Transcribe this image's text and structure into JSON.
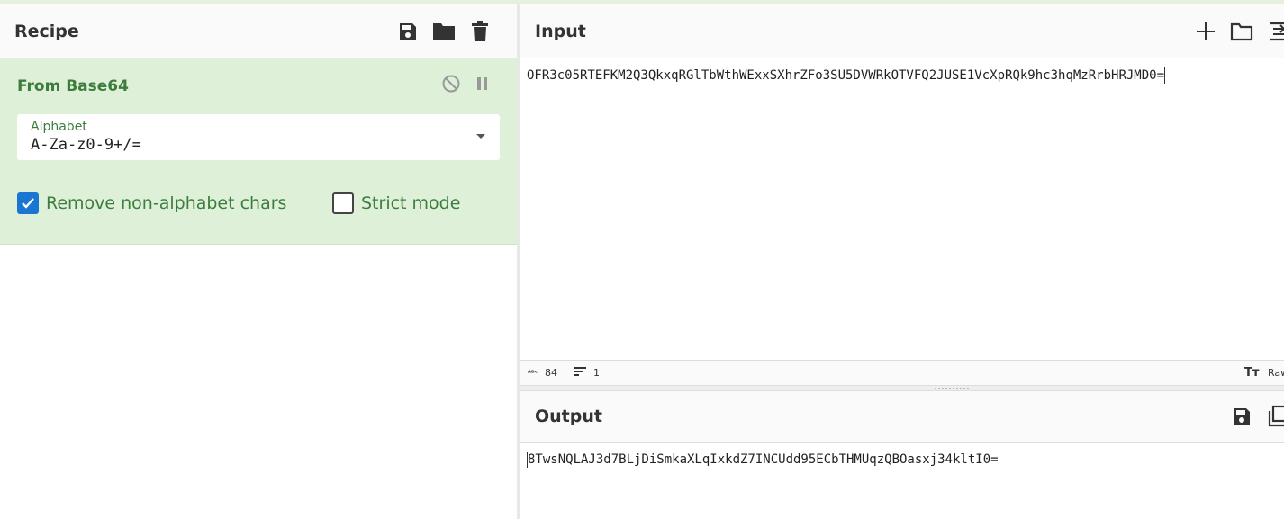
{
  "recipe": {
    "title": "Recipe",
    "icons": [
      "save-icon",
      "folder-icon",
      "trash-icon"
    ]
  },
  "operation": {
    "title": "From Base64",
    "alphabet_label": "Alphabet",
    "alphabet_value": "A-Za-z0-9+/=",
    "remove_nonalphabet_label": "Remove non-alphabet chars",
    "remove_nonalphabet_checked": true,
    "strict_mode_label": "Strict mode",
    "strict_mode_checked": false
  },
  "input": {
    "title": "Input",
    "text": "OFR3c05RTEFKM2Q3QkxqRGlTbWthWExxSXhrZFo3SU5DVWRkOTVFQ2JUSE1VcXpRQk9hc3hqMzRrbHRJMD0=",
    "char_count": "84",
    "line_count": "1",
    "format": "Raw"
  },
  "output": {
    "title": "Output",
    "text": "8TwsNQLAJ3d7BLjDiSmkaXLqIxkdZ7INCUdd95ECbTHMUqzQBOasxj34kltI0="
  },
  "colors": {
    "accent": "#3c7d3e",
    "operation_bg": "#dff0d8",
    "checkbox": "#1976d2"
  }
}
